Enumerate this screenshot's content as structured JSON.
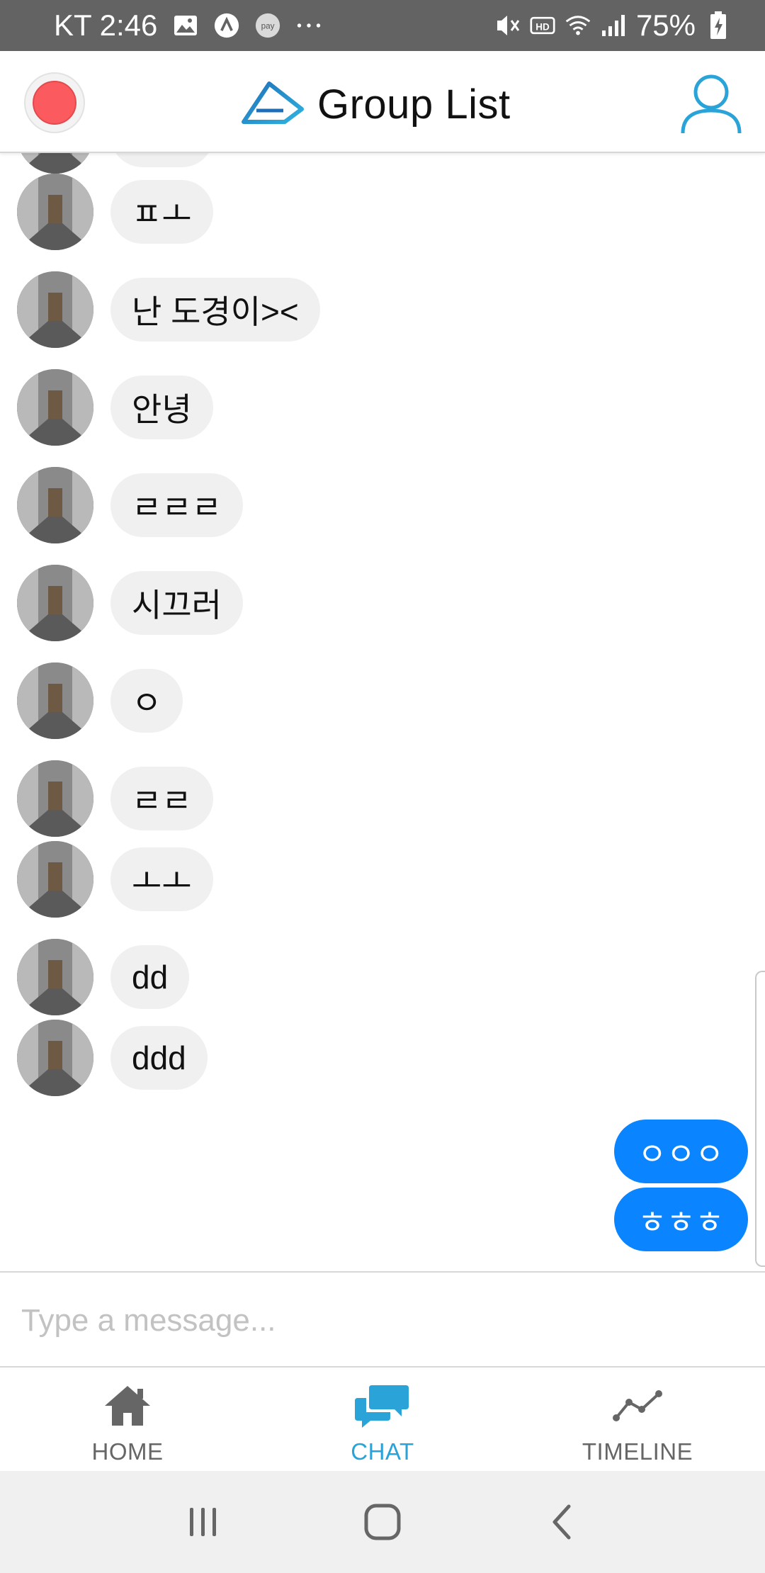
{
  "status_bar": {
    "carrier_time": "KT 2:46",
    "battery": "75%"
  },
  "header": {
    "title": "Group List",
    "colors": {
      "accent": "#2aa3d8",
      "record": "#fb5a5e"
    }
  },
  "messages": {
    "incoming": [
      {
        "text": "ㅍㅗ"
      },
      {
        "text": "난 도경이><"
      },
      {
        "text": "안녕"
      },
      {
        "text": "ㄹㄹㄹ"
      },
      {
        "text": "시끄러"
      },
      {
        "text": "ㅇ"
      },
      {
        "text": "ㄹㄹ"
      },
      {
        "text": "ㅗㅗ"
      },
      {
        "text": "dd"
      },
      {
        "text": "ddd"
      }
    ],
    "outgoing": [
      {
        "text": "ㅇㅇㅇ"
      },
      {
        "text": "ㅎㅎㅎ"
      }
    ],
    "colors": {
      "incoming_bubble": "#f0f0f0",
      "outgoing_bubble": "#0a84ff"
    }
  },
  "composer": {
    "placeholder": "Type a message...",
    "value": ""
  },
  "tabs": [
    {
      "label": "HOME",
      "icon": "home-icon",
      "active": false
    },
    {
      "label": "CHAT",
      "icon": "chat-icon",
      "active": true
    },
    {
      "label": "TIMELINE",
      "icon": "timeline-icon",
      "active": false
    }
  ],
  "tab_colors": {
    "active": "#2aa3d8",
    "inactive": "#666666"
  },
  "nav_bar": {
    "buttons": [
      "recent-apps-icon",
      "home-nav-icon",
      "back-icon"
    ]
  }
}
